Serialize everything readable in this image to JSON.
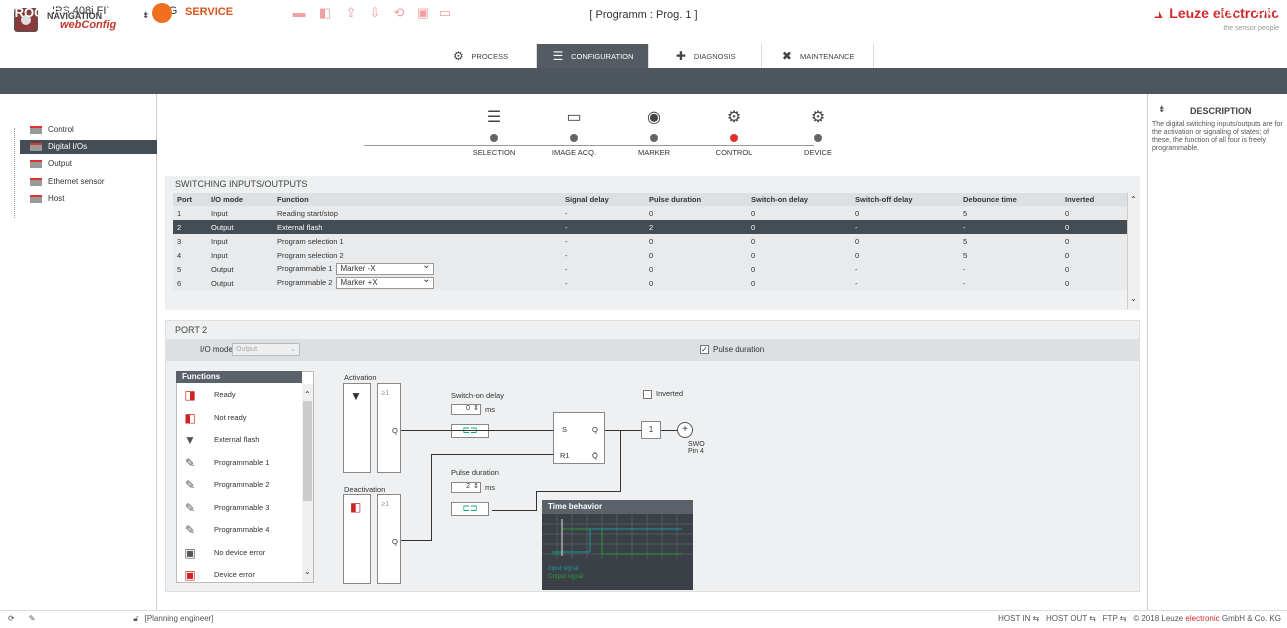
{
  "header": {
    "device": "IPS 408i FIX-F4-102-I3-G",
    "app": "webConfig",
    "program": "[ Programm : Prog. 1 ]",
    "brand": "Leuze electronic",
    "brand_sub": "the sensor people"
  },
  "tabs": [
    {
      "label": "PROCESS",
      "icon": "process-icon"
    },
    {
      "label": "CONFIGURATION",
      "icon": "configuration-icon"
    },
    {
      "label": "DIAGNOSIS",
      "icon": "diagnosis-icon"
    },
    {
      "label": "MAINTENANCE",
      "icon": "maintenance-icon"
    }
  ],
  "toolbar": {
    "process": "PROCESS",
    "service": "SERVICE",
    "lang": "EN"
  },
  "navigation": {
    "title": "NAVIGATION",
    "items": [
      "Control",
      "Digital I/Os",
      "Output",
      "Ethernet sensor",
      "Host"
    ],
    "selected": "Digital I/Os"
  },
  "steps": [
    {
      "label": "SELECTION"
    },
    {
      "label": "IMAGE ACQ."
    },
    {
      "label": "MARKER"
    },
    {
      "label": "CONTROL"
    },
    {
      "label": "DEVICE"
    }
  ],
  "switching": {
    "title": "SWITCHING INPUTS/OUTPUTS",
    "columns": [
      "Port",
      "I/O mode",
      "Function",
      "Signal delay",
      "Pulse duration",
      "Switch-on delay",
      "Switch-off delay",
      "Debounce time",
      "Inverted"
    ],
    "rows": [
      [
        "1",
        "Input",
        "Reading start/stop",
        "-",
        "0",
        "0",
        "0",
        "5",
        "0"
      ],
      [
        "2",
        "Output",
        "External flash",
        "-",
        "2",
        "0",
        "-",
        "-",
        "0"
      ],
      [
        "3",
        "Input",
        "Program selection 1",
        "-",
        "0",
        "0",
        "0",
        "5",
        "0"
      ],
      [
        "4",
        "Input",
        "Program selection 2",
        "-",
        "0",
        "0",
        "0",
        "5",
        "0"
      ],
      [
        "5",
        "Output",
        "Programmable 1",
        "-",
        "0",
        "0",
        "-",
        "-",
        "0"
      ],
      [
        "6",
        "Output",
        "Programmable 2",
        "-",
        "0",
        "0",
        "-",
        "-",
        "0"
      ]
    ],
    "selected_row": 2,
    "dropdowns": {
      "5": "Marker -X",
      "6": "Marker +X"
    }
  },
  "port": {
    "title": "PORT 2",
    "io_mode_label": "I/O mode",
    "io_mode_value": "Output",
    "pulse_duration_label": "Pulse duration",
    "pulse_duration_checked": true
  },
  "functions": {
    "title": "Functions",
    "items": [
      "Ready",
      "Not ready",
      "External flash",
      "Programmable 1",
      "Programmable 2",
      "Programmable 3",
      "Programmable 4",
      "No device error",
      "Device error"
    ]
  },
  "logic": {
    "activation": "Activation",
    "deactivation": "Deactivation",
    "switch_on_delay": "Switch-on delay",
    "switch_on_value": "0",
    "pulse_duration": "Pulse duration",
    "pulse_value": "2",
    "unit": "ms",
    "inverted": "Inverted",
    "swo": "SWO",
    "pin": "Pin 4",
    "ge1": "≥1",
    "q": "Q",
    "s": "S",
    "r1": "R1",
    "one": "1"
  },
  "time_behavior": {
    "title": "Time behavior",
    "legend": [
      "Input signal",
      "Output signal"
    ]
  },
  "description": {
    "title": "DESCRIPTION",
    "text": "The digital switching inputs/outputs are for the activation or signaling of states; of these, the function of all four is freely programmable."
  },
  "status": {
    "user": "[Planning engineer]",
    "host_in": "HOST IN",
    "host_out": "HOST OUT",
    "ftp": "FTP",
    "copyright_pre": "© 2018 Leuze ",
    "copyright_brand": "electronic",
    "copyright_post": " GmbH & Co. KG"
  },
  "colors": {
    "accent": "#f07020",
    "brand": "#d12a2a",
    "toolbar": "#4d555d",
    "selected": "#444c54"
  }
}
